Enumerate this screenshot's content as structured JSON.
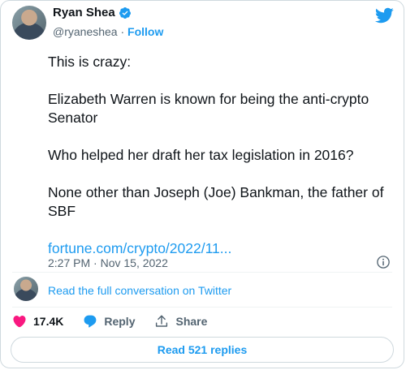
{
  "author": {
    "name": "Ryan Shea",
    "handle": "@ryaneshea",
    "separator": " · ",
    "follow_label": "Follow"
  },
  "tweet": {
    "paragraphs": [
      "This is crazy:",
      "Elizabeth Warren is known for being the anti-crypto Senator",
      "Who helped her draft her tax legislation in 2016?",
      "None other than Joseph (Joe) Bankman, the father of SBF"
    ],
    "link": "fortune.com/crypto/2022/11...",
    "timestamp": "2:27 PM · Nov 15, 2022"
  },
  "conversation": {
    "link_label": "Read the full conversation on Twitter"
  },
  "actions": {
    "likes": "17.4K",
    "reply_label": "Reply",
    "share_label": "Share"
  },
  "footer": {
    "read_replies_label": "Read 521 replies"
  },
  "colors": {
    "accent": "#1d9bf0",
    "like": "#f91880",
    "muted": "#536471"
  }
}
